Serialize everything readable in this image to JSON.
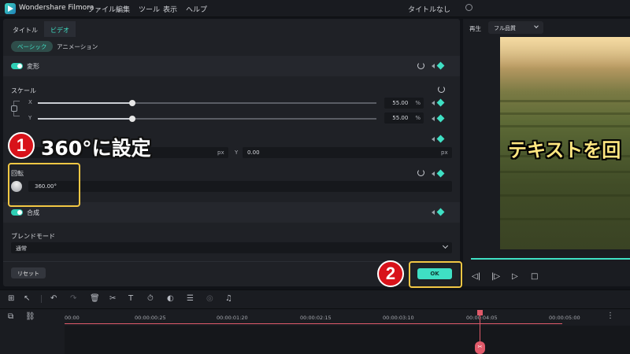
{
  "app": {
    "name": "Wondershare Filmora",
    "menu": [
      "ファイル",
      "編集",
      "ツール",
      "表示",
      "ヘルプ"
    ],
    "doc_title": "タイトルなし"
  },
  "panel": {
    "tabs": [
      "タイトル",
      "ビデオ"
    ],
    "active_tab": "ビデオ",
    "subtabs": [
      "ベーシック",
      "アニメーション"
    ],
    "active_subtab": "ベーシック",
    "transform": {
      "label": "変形",
      "enabled": true
    },
    "scale": {
      "label": "スケール",
      "x_label": "X",
      "x_value": "55.00",
      "x_unit": "%",
      "x_fraction": 0.55,
      "y_label": "Y",
      "y_value": "55.00",
      "y_unit": "%",
      "y_fraction": 0.55
    },
    "position": {
      "x_unit": "px",
      "y_label": "Y",
      "y_value": "0.00",
      "y_unit": "px"
    },
    "rotation": {
      "label": "回転",
      "value": "360.00°"
    },
    "composite": {
      "label": "合成",
      "enabled": true
    },
    "blend": {
      "label": "ブレンドモード",
      "value": "通常"
    },
    "reset_label": "リセット",
    "ok_label": "OK"
  },
  "callouts": {
    "one": {
      "number": "1",
      "text": "360°に設定"
    },
    "two": {
      "number": "2"
    }
  },
  "preview": {
    "play_label": "再生",
    "quality": "フル品質",
    "caption": "テキストを回"
  },
  "timeline": {
    "timecodes": [
      "00:00",
      "00:00:00:25",
      "00:00:01:20",
      "00:00:02:15",
      "00:00:03:10",
      "00:00:04:05",
      "00:00:05:00"
    ]
  },
  "colors": {
    "accent": "#3fe0c4",
    "callout_border": "#f2c744",
    "callout_badge": "#d8121a",
    "playhead": "#e05a6a"
  }
}
